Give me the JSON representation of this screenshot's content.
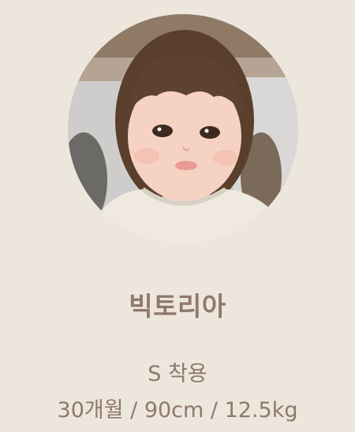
{
  "model": {
    "name": "빅토리아",
    "size_label": "S 착용",
    "stats": "30개월 / 90cm / 12.5kg",
    "photo_alt": "model-portrait"
  },
  "colors": {
    "background": "#ede6dd",
    "text": "#8f786c"
  }
}
